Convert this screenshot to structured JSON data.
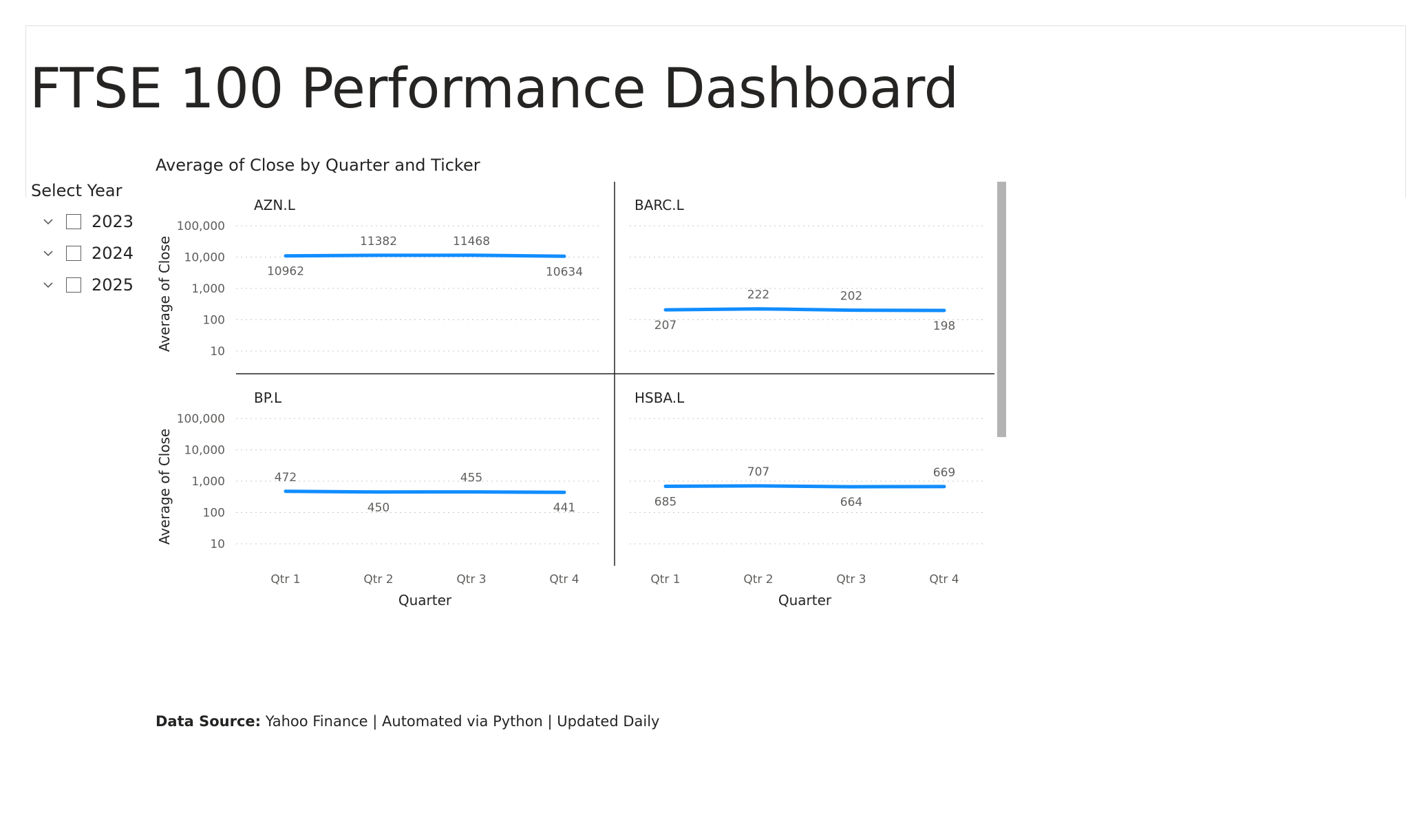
{
  "page": {
    "title": "FTSE 100 Performance Dashboard"
  },
  "slicer": {
    "title": "Select Year",
    "items": [
      {
        "label": "2023",
        "checked": false
      },
      {
        "label": "2024",
        "checked": false
      },
      {
        "label": "2025",
        "checked": false
      }
    ]
  },
  "footer": {
    "label": "Data Source:",
    "text": "Yahoo Finance | Automated via Python | Updated Daily"
  },
  "colors": {
    "line": "#118DFF",
    "text": "#252423",
    "muted": "#605e5c",
    "grid": "#c8c6c4"
  },
  "chart_data": {
    "type": "line",
    "title": "Average of Close by Quarter and Ticker",
    "xlabel": "Quarter",
    "ylabel": "Average of Close",
    "yscale": "log",
    "ylim": [
      10,
      100000
    ],
    "y_ticks": [
      "100,000",
      "10,000",
      "1,000",
      "100",
      "10"
    ],
    "y_tick_values": [
      100000,
      10000,
      1000,
      100,
      10
    ],
    "categories": [
      "Qtr 1",
      "Qtr 2",
      "Qtr 3",
      "Qtr 4"
    ],
    "grid": true,
    "panels": [
      {
        "name": "AZN.L",
        "values": [
          10962,
          11382,
          11468,
          10634
        ],
        "labels": [
          "10962",
          "11382",
          "11468",
          "10634"
        ],
        "label_pos": [
          "below",
          "above",
          "above",
          "below"
        ]
      },
      {
        "name": "BARC.L",
        "values": [
          207,
          222,
          202,
          198
        ],
        "labels": [
          "207",
          "222",
          "202",
          "198"
        ],
        "label_pos": [
          "below",
          "above",
          "above",
          "below"
        ]
      },
      {
        "name": "BP.L",
        "values": [
          472,
          450,
          455,
          441
        ],
        "labels": [
          "472",
          "450",
          "455",
          "441"
        ],
        "label_pos": [
          "above",
          "below",
          "above",
          "below"
        ]
      },
      {
        "name": "HSBA.L",
        "values": [
          685,
          707,
          664,
          669
        ],
        "labels": [
          "685",
          "707",
          "664",
          "669"
        ],
        "label_pos": [
          "below",
          "above",
          "below",
          "above"
        ]
      }
    ]
  }
}
